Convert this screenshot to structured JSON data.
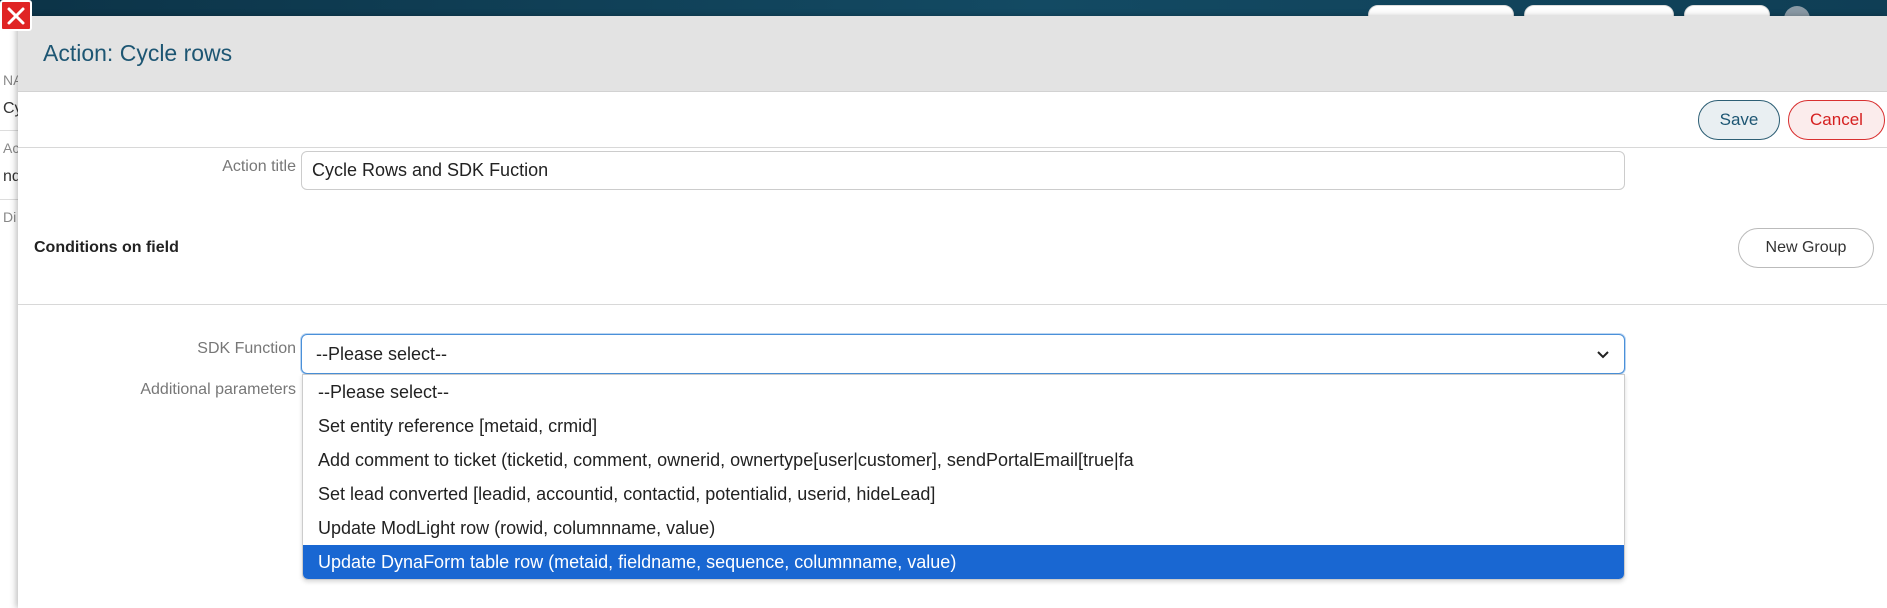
{
  "background": {
    "left_labels": [
      "NA",
      "Cy",
      "Ac",
      "nd",
      "Di"
    ]
  },
  "modal": {
    "title": "Action: Cycle rows",
    "toolbar": {
      "save_label": "Save",
      "cancel_label": "Cancel"
    },
    "action_title": {
      "label": "Action title",
      "value": "Cycle Rows and SDK Fuction"
    },
    "conditions": {
      "title": "Conditions on field",
      "new_group_label": "New Group"
    },
    "sdk_function": {
      "label": "SDK Function",
      "selected": "--Please select--",
      "options": [
        "--Please select--",
        "Set entity reference [metaid, crmid]",
        "Add comment to ticket (ticketid, comment, ownerid, ownertype[user|customer], sendPortalEmail[true|fa",
        "Set lead converted [leadid, accountid, contactid, potentialid, userid, hideLead]",
        "Update ModLight row (rowid, columnname, value)",
        "Update DynaForm table row (metaid, fieldname, sequence, columnname, value)"
      ],
      "highlighted_index": 5
    },
    "additional_parameters": {
      "label": "Additional parameters"
    }
  },
  "colors": {
    "title": "#1d5673",
    "highlight": "#1967d2",
    "cancel": "#d52020"
  }
}
